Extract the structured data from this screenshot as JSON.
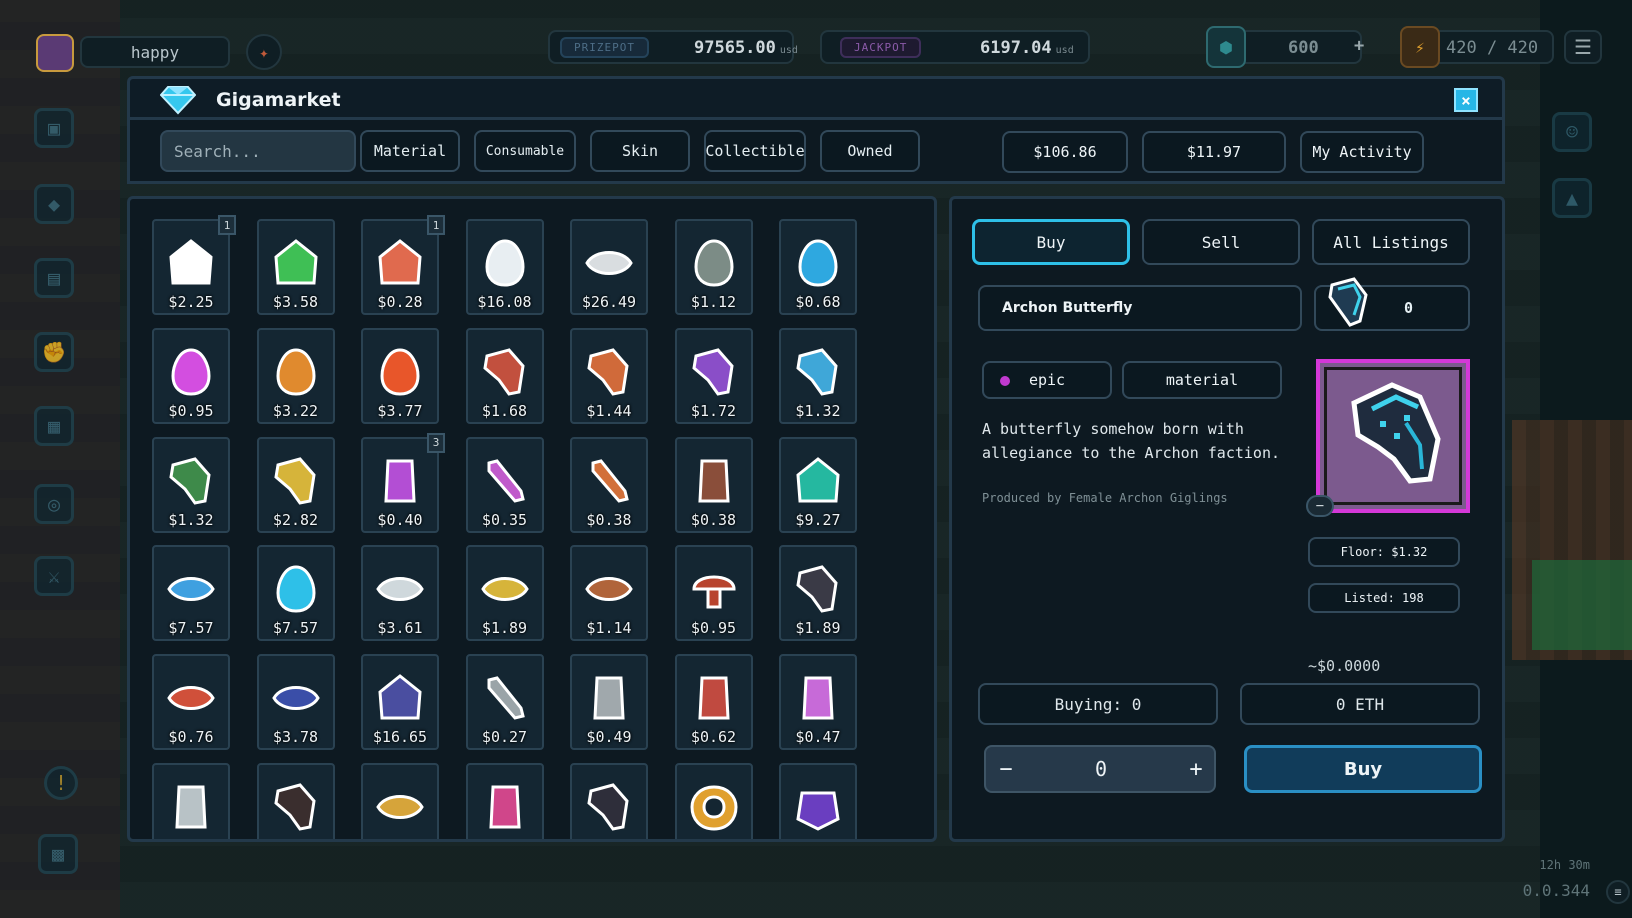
{
  "hud": {
    "username": "happy",
    "prizepot_label": "PRIZEPOT",
    "prizepot_value": "97565.00",
    "prizepot_unit": "usd",
    "jackpot_label": "JACKPOT",
    "jackpot_value": "6197.04",
    "jackpot_unit": "usd",
    "gems": "600",
    "gems_plus": "+",
    "energy": "420 / 420"
  },
  "window": {
    "title": "Gigamarket",
    "close": "×"
  },
  "toolbar": {
    "search_placeholder": "Search...",
    "filters": [
      "Material",
      "Consumable",
      "Skin",
      "Collectible",
      "Owned"
    ],
    "balance_1": "$106.86",
    "balance_2": "$11.97",
    "my_activity": "My Activity"
  },
  "grid": {
    "items": [
      {
        "price": "$2.25",
        "badge": "1",
        "icon": "party-ghost-icon",
        "color": "#ffffff"
      },
      {
        "price": "$3.58",
        "badge": "",
        "icon": "green-bird-icon",
        "color": "#3fbf55"
      },
      {
        "price": "$0.28",
        "badge": "1",
        "icon": "monkey-icon",
        "color": "#e06a4e"
      },
      {
        "price": "$16.08",
        "badge": "",
        "icon": "white-egg-icon",
        "color": "#e8eef2"
      },
      {
        "price": "$26.49",
        "badge": "",
        "icon": "eye-icon",
        "color": "#d9dde0"
      },
      {
        "price": "$1.12",
        "badge": "",
        "icon": "gray-egg-icon",
        "color": "#7c8c86"
      },
      {
        "price": "$0.68",
        "badge": "",
        "icon": "blue-egg-icon",
        "color": "#2ea8e0"
      },
      {
        "price": "$0.95",
        "badge": "",
        "icon": "pink-egg-icon",
        "color": "#d34ee0"
      },
      {
        "price": "$3.22",
        "badge": "",
        "icon": "orange-egg-icon",
        "color": "#e08a2e"
      },
      {
        "price": "$3.77",
        "badge": "",
        "icon": "fire-egg-icon",
        "color": "#e8562a"
      },
      {
        "price": "$1.68",
        "badge": "",
        "icon": "red-wing-icon",
        "color": "#c2503e"
      },
      {
        "price": "$1.44",
        "badge": "",
        "icon": "orange-wing-icon",
        "color": "#d06a3a"
      },
      {
        "price": "$1.72",
        "badge": "",
        "icon": "purple-wing-icon",
        "color": "#8a4ec8"
      },
      {
        "price": "$1.32",
        "badge": "",
        "icon": "blue-wing-icon",
        "color": "#3fa7d8"
      },
      {
        "price": "$1.32",
        "badge": "",
        "icon": "green-wing-icon",
        "color": "#3e8a4a"
      },
      {
        "price": "$2.82",
        "badge": "",
        "icon": "gold-wing-icon",
        "color": "#d6b43a"
      },
      {
        "price": "$0.40",
        "badge": "3",
        "icon": "purple-potion-icon",
        "color": "#b34ed4"
      },
      {
        "price": "$0.35",
        "badge": "",
        "icon": "pink-bone-icon",
        "color": "#c05acb"
      },
      {
        "price": "$0.38",
        "badge": "",
        "icon": "orange-bone-icon",
        "color": "#d2703a"
      },
      {
        "price": "$0.38",
        "badge": "",
        "icon": "brown-jar-icon",
        "color": "#8a4e3a"
      },
      {
        "price": "$9.27",
        "badge": "",
        "icon": "teal-creature-icon",
        "color": "#25b8a0"
      },
      {
        "price": "$7.57",
        "badge": "",
        "icon": "blue-eye-icon",
        "color": "#3fa0e0"
      },
      {
        "price": "$7.57",
        "badge": "",
        "icon": "blue-crystal-icon",
        "color": "#2ec0e8"
      },
      {
        "price": "$3.61",
        "badge": "",
        "icon": "silver-eye-icon",
        "color": "#cfd8dc"
      },
      {
        "price": "$1.89",
        "badge": "",
        "icon": "striped-orb-icon",
        "color": "#d6b43a"
      },
      {
        "price": "$1.14",
        "badge": "",
        "icon": "bronze-eye-icon",
        "color": "#b0643a"
      },
      {
        "price": "$0.95",
        "badge": "",
        "icon": "red-mushroom-icon",
        "color": "#b8442e"
      },
      {
        "price": "$1.89",
        "badge": "",
        "icon": "dark-wing-icon",
        "color": "#3a3a46"
      },
      {
        "price": "$0.76",
        "badge": "",
        "icon": "red-eye-icon",
        "color": "#d0503a"
      },
      {
        "price": "$3.78",
        "badge": "",
        "icon": "navy-eye-icon",
        "color": "#3a4ea8"
      },
      {
        "price": "$16.65",
        "badge": "",
        "icon": "treasure-chest-icon",
        "color": "#4a4ea0"
      },
      {
        "price": "$0.27",
        "badge": "",
        "icon": "gray-bone-icon",
        "color": "#9aa4a8"
      },
      {
        "price": "$0.49",
        "badge": "",
        "icon": "gray-jar-icon",
        "color": "#a0a8ac"
      },
      {
        "price": "$0.62",
        "badge": "",
        "icon": "red-vial-icon",
        "color": "#c04a40"
      },
      {
        "price": "$0.47",
        "badge": "",
        "icon": "pink-vial-icon",
        "color": "#c76ad8"
      },
      {
        "price": "",
        "badge": "",
        "icon": "clear-vial-icon",
        "color": "#b8c2c6"
      },
      {
        "price": "",
        "badge": "",
        "icon": "dark-bat-icon",
        "color": "#3a2e2e"
      },
      {
        "price": "",
        "badge": "",
        "icon": "gold-eye-icon",
        "color": "#d6a43a"
      },
      {
        "price": "",
        "badge": "",
        "icon": "pink-potion-icon",
        "color": "#d0468a"
      },
      {
        "price": "",
        "badge": "",
        "icon": "black-wing-icon",
        "color": "#2e2e3a"
      },
      {
        "price": "",
        "badge": "",
        "icon": "ring-icon",
        "color": "#e0a02e"
      },
      {
        "price": "",
        "badge": "",
        "icon": "purple-beetle-icon",
        "color": "#6a3ec0"
      }
    ]
  },
  "detail": {
    "tabs": [
      "Buy",
      "Sell",
      "All Listings"
    ],
    "active_tab": "Buy",
    "item_name": "Archon Butterfly",
    "owned_count": "0",
    "rarity": "epic",
    "rarity_color": "#c13ad0",
    "category": "material",
    "description": "A butterfly somehow born with allegiance to the Archon faction.",
    "produced_by": "Produced by Female Archon Giglings",
    "preview_minus": "−",
    "floor": "Floor: $1.32",
    "listed": "Listed: 198",
    "usd_estimate": "~$0.0000",
    "buying": "Buying: 0",
    "eth": "0 ETH",
    "stepper_minus": "−",
    "stepper_value": "0",
    "stepper_plus": "+",
    "buy_button": "Buy"
  },
  "footer": {
    "timer": "12h 30m",
    "version": "0.0.344"
  }
}
